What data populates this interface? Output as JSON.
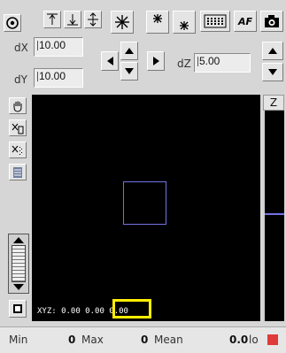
{
  "toolbar": {
    "icons": [
      "target-icon",
      "arrow-up-top-icon",
      "arrow-down-bottom-icon",
      "arrow-mid-icon",
      "asterisk-icon",
      "asterisk-up-icon",
      "asterisk-down-icon",
      "grid-icon",
      "af-text",
      "camera-icon"
    ],
    "af_label": "AF"
  },
  "stage": {
    "dx_label": "dX",
    "dx_value": "10.00",
    "dy_label": "dY",
    "dy_value": "10.00",
    "dz_label": "dZ",
    "dz_value": "5.00"
  },
  "side_tools": [
    "hand-icon",
    "cross-select-icon",
    "cross-dots-icon",
    "list-icon"
  ],
  "z_panel": {
    "label": "Z"
  },
  "canvas": {
    "coords_prefix": "XYZ: 0.00 0.00 ",
    "coords_highlight": "0.00"
  },
  "status": {
    "min_label": "Min",
    "min_value": "0",
    "max_label": "Max",
    "max_value": "0",
    "mean_label": "Mean",
    "mean_value": "0.0",
    "tail_label": "lo",
    "swatch_color": "#e03a3a"
  },
  "colors": {
    "roi_box": "#7272e6",
    "highlight": "#ffee00"
  }
}
